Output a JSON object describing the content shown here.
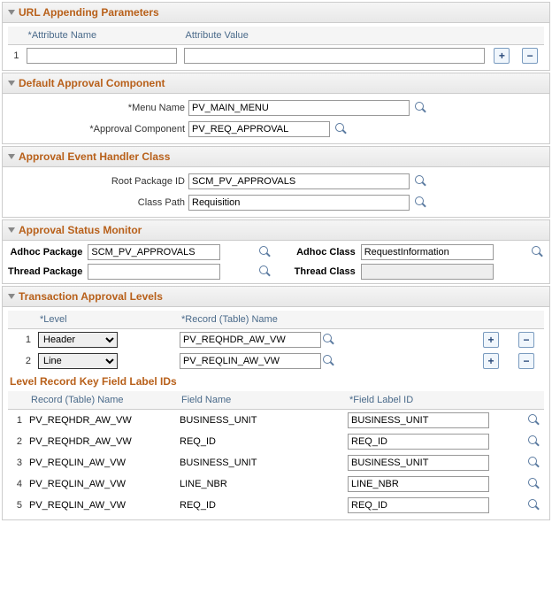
{
  "url_params": {
    "title": "URL Appending Parameters",
    "cols": {
      "attr_name": "Attribute Name",
      "attr_value": "Attribute Value"
    },
    "rows": [
      {
        "n": "1",
        "name": "",
        "value": ""
      }
    ]
  },
  "default_approval": {
    "title": "Default Approval Component",
    "menu_name_label": "Menu Name",
    "menu_name": "PV_MAIN_MENU",
    "approval_component_label": "Approval Component",
    "approval_component": "PV_REQ_APPROVAL"
  },
  "event_handler": {
    "title": "Approval Event Handler Class",
    "root_pkg_label": "Root Package ID",
    "root_pkg": "SCM_PV_APPROVALS",
    "class_path_label": "Class Path",
    "class_path": "Requisition"
  },
  "status_monitor": {
    "title": "Approval Status Monitor",
    "adhoc_pkg_label": "Adhoc Package",
    "adhoc_pkg": "SCM_PV_APPROVALS",
    "adhoc_class_label": "Adhoc Class",
    "adhoc_class": "RequestInformation",
    "thread_pkg_label": "Thread Package",
    "thread_pkg": "",
    "thread_class_label": "Thread Class",
    "thread_class": ""
  },
  "approval_levels": {
    "title": "Transaction Approval Levels",
    "cols": {
      "level": "Level",
      "record": "Record (Table) Name"
    },
    "rows": [
      {
        "n": "1",
        "level": "Header",
        "record": "PV_REQHDR_AW_VW"
      },
      {
        "n": "2",
        "level": "Line",
        "record": "PV_REQLIN_AW_VW"
      }
    ],
    "level_options": [
      "Header",
      "Line"
    ]
  },
  "key_fields": {
    "title": "Level Record Key Field Label IDs",
    "cols": {
      "record": "Record (Table) Name",
      "field": "Field Name",
      "label": "Field Label ID"
    },
    "rows": [
      {
        "n": "1",
        "record": "PV_REQHDR_AW_VW",
        "field": "BUSINESS_UNIT",
        "label": "BUSINESS_UNIT"
      },
      {
        "n": "2",
        "record": "PV_REQHDR_AW_VW",
        "field": "REQ_ID",
        "label": "REQ_ID"
      },
      {
        "n": "3",
        "record": "PV_REQLIN_AW_VW",
        "field": "BUSINESS_UNIT",
        "label": "BUSINESS_UNIT"
      },
      {
        "n": "4",
        "record": "PV_REQLIN_AW_VW",
        "field": "LINE_NBR",
        "label": "LINE_NBR"
      },
      {
        "n": "5",
        "record": "PV_REQLIN_AW_VW",
        "field": "REQ_ID",
        "label": "REQ_ID"
      }
    ]
  }
}
